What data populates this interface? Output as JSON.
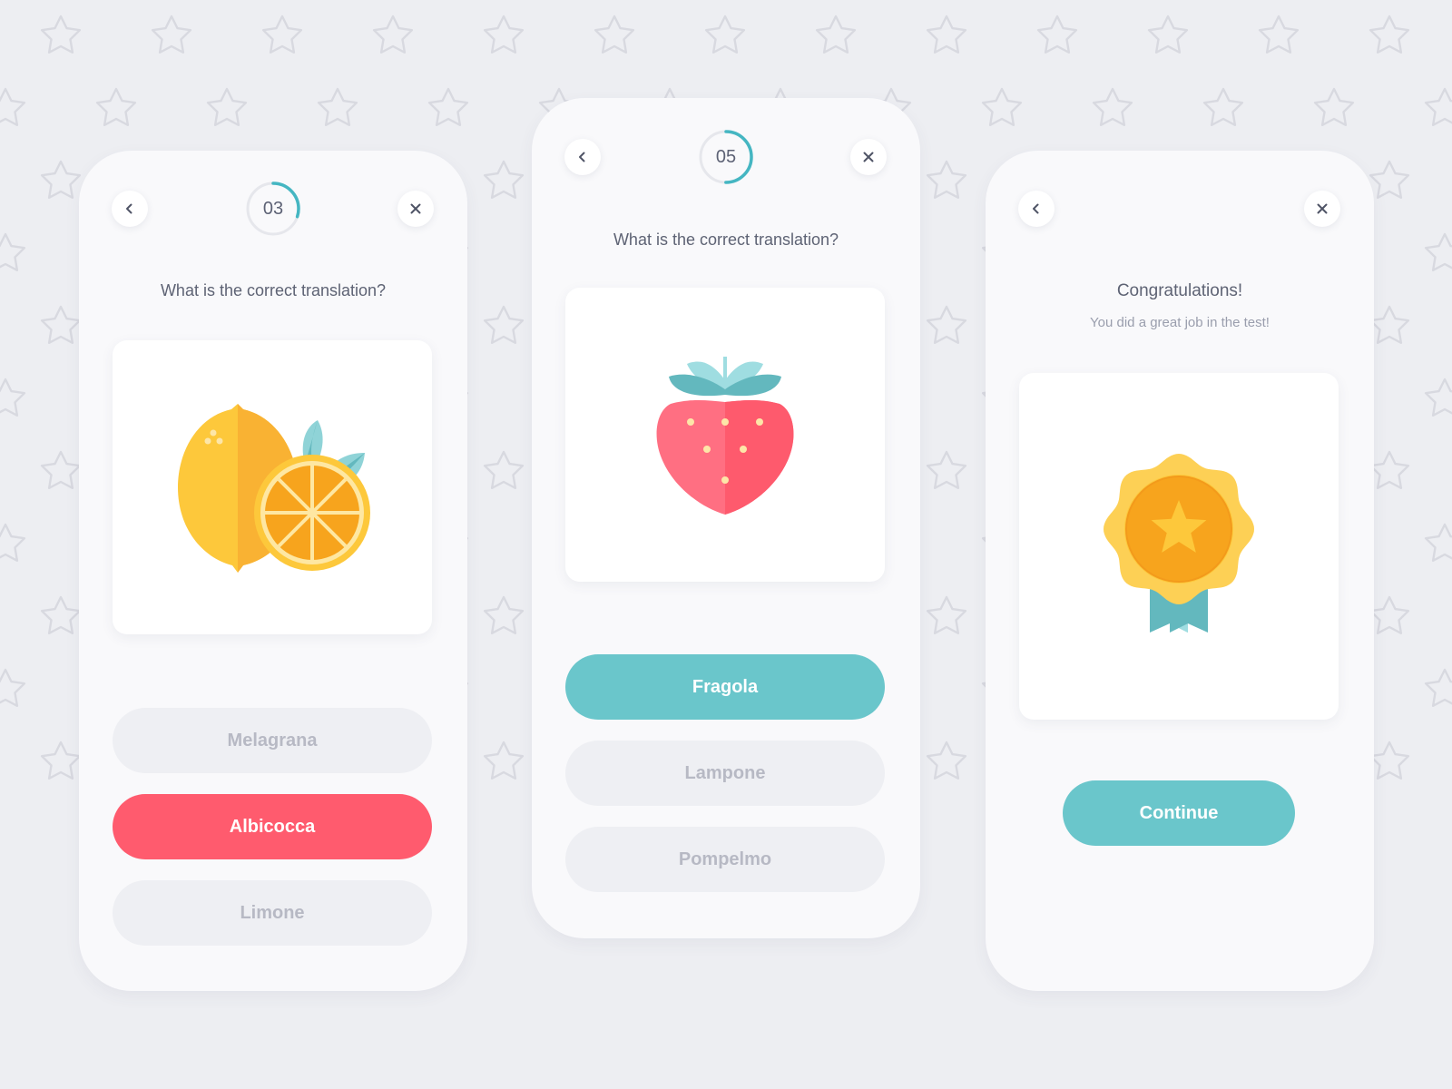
{
  "colors": {
    "background": "#edeef2",
    "card": "#f9f9fb",
    "accent_teal": "#6ac6cb",
    "error_red": "#ff5b6e",
    "neutral_option": "#eeeff3"
  },
  "screens": [
    {
      "progress": "03",
      "progress_fraction": 0.3,
      "question": "What is the correct translation?",
      "image_icon": "lemon-orange-icon",
      "options": [
        {
          "label": "Melagrana",
          "state": "neutral"
        },
        {
          "label": "Albicocca",
          "state": "wrong"
        },
        {
          "label": "Limone",
          "state": "neutral"
        }
      ]
    },
    {
      "progress": "05",
      "progress_fraction": 0.5,
      "question": "What is the correct translation?",
      "image_icon": "strawberry-icon",
      "options": [
        {
          "label": "Fragola",
          "state": "correct"
        },
        {
          "label": "Lampone",
          "state": "neutral"
        },
        {
          "label": "Pompelmo",
          "state": "neutral"
        }
      ]
    },
    {
      "title": "Congratulations!",
      "subtitle": "You did a great job in the test!",
      "image_icon": "medal-star-icon",
      "continue_label": "Continue"
    }
  ]
}
